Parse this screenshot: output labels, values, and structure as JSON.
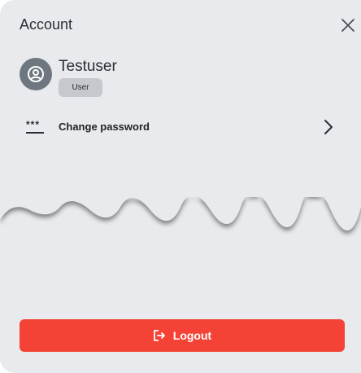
{
  "header": {
    "title": "Account",
    "close_icon": "close-icon"
  },
  "user": {
    "name": "Testuser",
    "role": "User",
    "avatar_icon": "account-circle-icon"
  },
  "menu": {
    "change_password": {
      "label": "Change password",
      "icon": "password-icon",
      "stars": "***",
      "chevron_icon": "chevron-right-icon"
    }
  },
  "footer": {
    "logout_label": "Logout",
    "logout_icon": "logout-icon"
  },
  "colors": {
    "panel_background": "#e8eaed",
    "logout_button": "#f44336",
    "avatar": "#6e7780",
    "badge": "#c5c8cc"
  }
}
